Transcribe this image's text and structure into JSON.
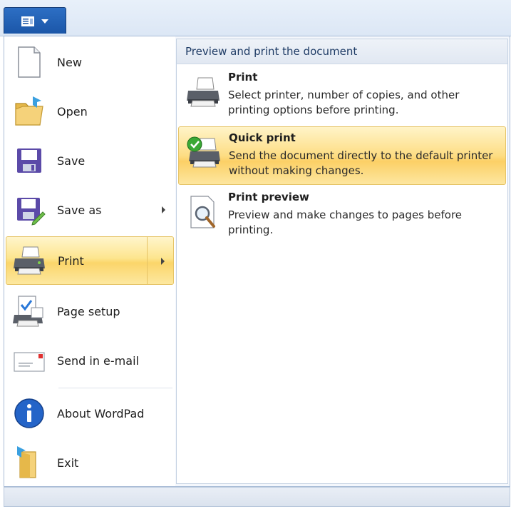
{
  "left_menu": {
    "items": [
      {
        "label": "New",
        "icon": "new-document-icon"
      },
      {
        "label": "Open",
        "icon": "open-folder-icon"
      },
      {
        "label": "Save",
        "icon": "save-disk-icon"
      },
      {
        "label": "Save as",
        "icon": "save-as-icon",
        "has_submenu": true
      },
      {
        "label": "Print",
        "icon": "printer-icon",
        "has_submenu": true,
        "selected": true
      },
      {
        "label": "Page setup",
        "icon": "page-setup-icon"
      },
      {
        "label": "Send in e-mail",
        "icon": "email-icon"
      },
      {
        "label": "About WordPad",
        "icon": "info-icon"
      },
      {
        "label": "Exit",
        "icon": "exit-icon"
      }
    ]
  },
  "submenu": {
    "header": "Preview and print the document",
    "items": [
      {
        "title": "Print",
        "description": "Select printer, number of copies, and other printing options before printing.",
        "icon": "printer-icon"
      },
      {
        "title": "Quick print",
        "description": "Send the document directly to the default printer without making changes.",
        "icon": "quick-print-icon",
        "highlighted": true
      },
      {
        "title": "Print preview",
        "description": "Preview and make changes to pages before printing.",
        "icon": "print-preview-icon"
      }
    ]
  },
  "colors": {
    "highlight": "#fddd84",
    "app_button": "#1b56a8"
  }
}
